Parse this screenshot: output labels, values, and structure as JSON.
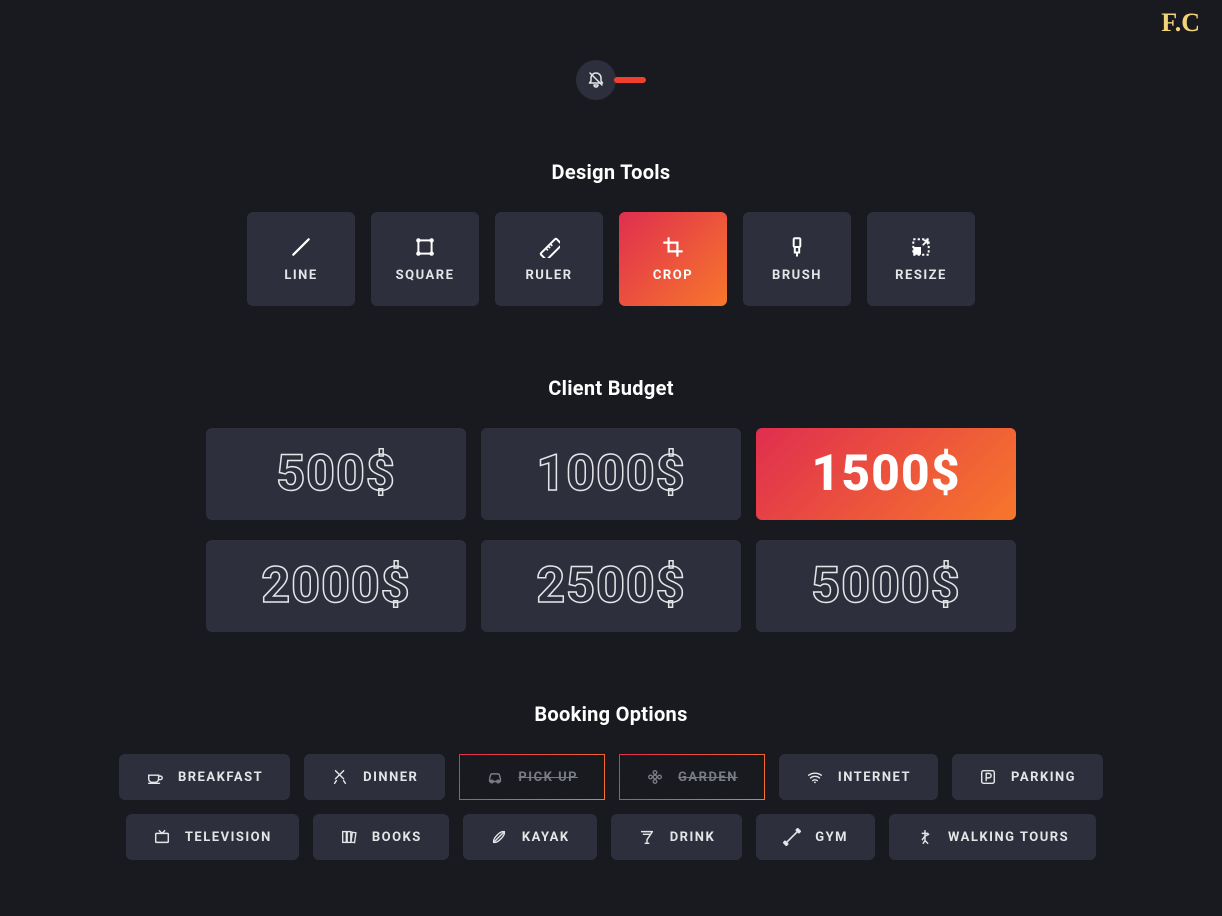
{
  "logo": "F.C",
  "designTools": {
    "title": "Design Tools",
    "items": [
      {
        "label": "LINE",
        "icon": "line-icon",
        "active": false
      },
      {
        "label": "SQUARE",
        "icon": "square-icon",
        "active": false
      },
      {
        "label": "RULER",
        "icon": "ruler-icon",
        "active": false
      },
      {
        "label": "CROP",
        "icon": "crop-icon",
        "active": true
      },
      {
        "label": "BRUSH",
        "icon": "brush-icon",
        "active": false
      },
      {
        "label": "RESIZE",
        "icon": "resize-icon",
        "active": false
      }
    ]
  },
  "clientBudget": {
    "title": "Client Budget",
    "items": [
      {
        "label": "500$",
        "active": false
      },
      {
        "label": "1000$",
        "active": false
      },
      {
        "label": "1500$",
        "active": true
      },
      {
        "label": "2000$",
        "active": false
      },
      {
        "label": "2500$",
        "active": false
      },
      {
        "label": "5000$",
        "active": false
      }
    ]
  },
  "bookingOptions": {
    "title": "Booking Options",
    "items": [
      {
        "label": "BREAKFAST",
        "icon": "coffee-icon",
        "disabled": false
      },
      {
        "label": "DINNER",
        "icon": "utensils-icon",
        "disabled": false
      },
      {
        "label": "PICK UP",
        "icon": "car-icon",
        "disabled": true
      },
      {
        "label": "GARDEN",
        "icon": "flower-icon",
        "disabled": true
      },
      {
        "label": "INTERNET",
        "icon": "wifi-icon",
        "disabled": false
      },
      {
        "label": "PARKING",
        "icon": "parking-icon",
        "disabled": false
      },
      {
        "label": "TELEVISION",
        "icon": "tv-icon",
        "disabled": false
      },
      {
        "label": "BOOKS",
        "icon": "books-icon",
        "disabled": false
      },
      {
        "label": "KAYAK",
        "icon": "kayak-icon",
        "disabled": false
      },
      {
        "label": "DRINK",
        "icon": "drink-icon",
        "disabled": false
      },
      {
        "label": "GYM",
        "icon": "gym-icon",
        "disabled": false
      },
      {
        "label": "WALKING TOURS",
        "icon": "walking-icon",
        "disabled": false
      }
    ]
  }
}
